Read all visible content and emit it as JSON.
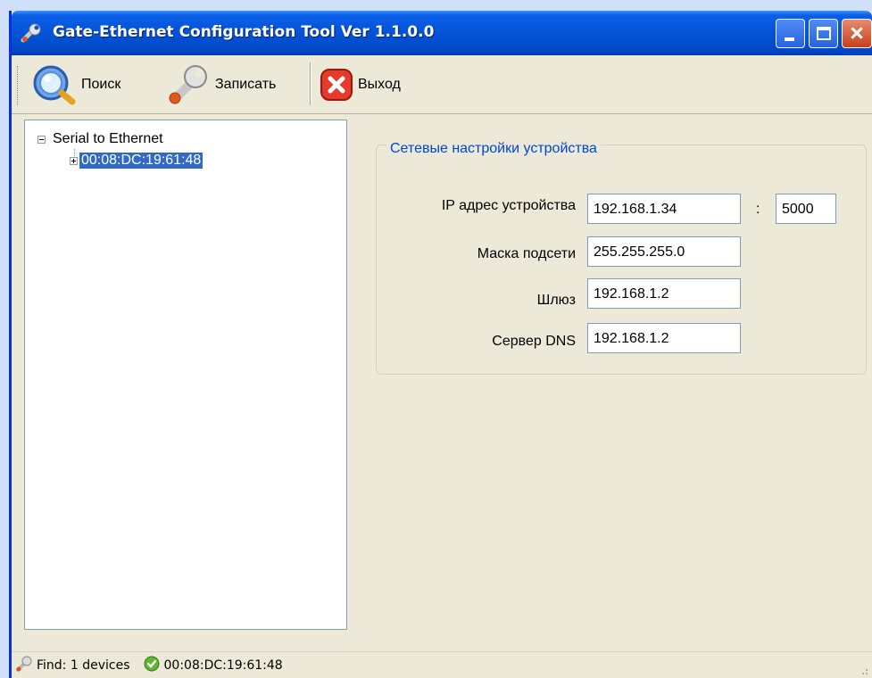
{
  "window": {
    "title": "Gate-Ethernet Configuration Tool Ver 1.1.0.0",
    "icons": [
      "wrench-icon",
      "minimize-icon",
      "maximize-icon",
      "close-icon"
    ]
  },
  "toolbar": {
    "search_label": "Поиск",
    "write_label": "Записать",
    "exit_label": "Выход",
    "icons": [
      "magnifier-icon",
      "wrench-icon",
      "exit-icon"
    ]
  },
  "tree": {
    "root_label": "Serial to Ethernet",
    "child_label": "00:08:DC:19:61:48"
  },
  "network": {
    "group_title": "Сетевые настройки устройства",
    "ip_label": "IP адрес устройства",
    "ip_value": "192.168.1.34",
    "port_separator": ":",
    "port_value": "5000",
    "mask_label": "Маска подсети",
    "mask_value": "255.255.255.0",
    "gateway_label": "Шлюз",
    "gateway_value": "192.168.1.2",
    "dns_label": "Сервер DNS",
    "dns_value": "192.168.1.2"
  },
  "status": {
    "find_text": "Find: 1 devices",
    "device_text": "00:08:DC:19:61:48",
    "icons": [
      "wrench-icon",
      "check-icon"
    ]
  },
  "colors": {
    "titlebar": "#0553d6",
    "selection": "#316ac5",
    "legend_text": "#0046d5",
    "close_button": "#c8401c"
  }
}
